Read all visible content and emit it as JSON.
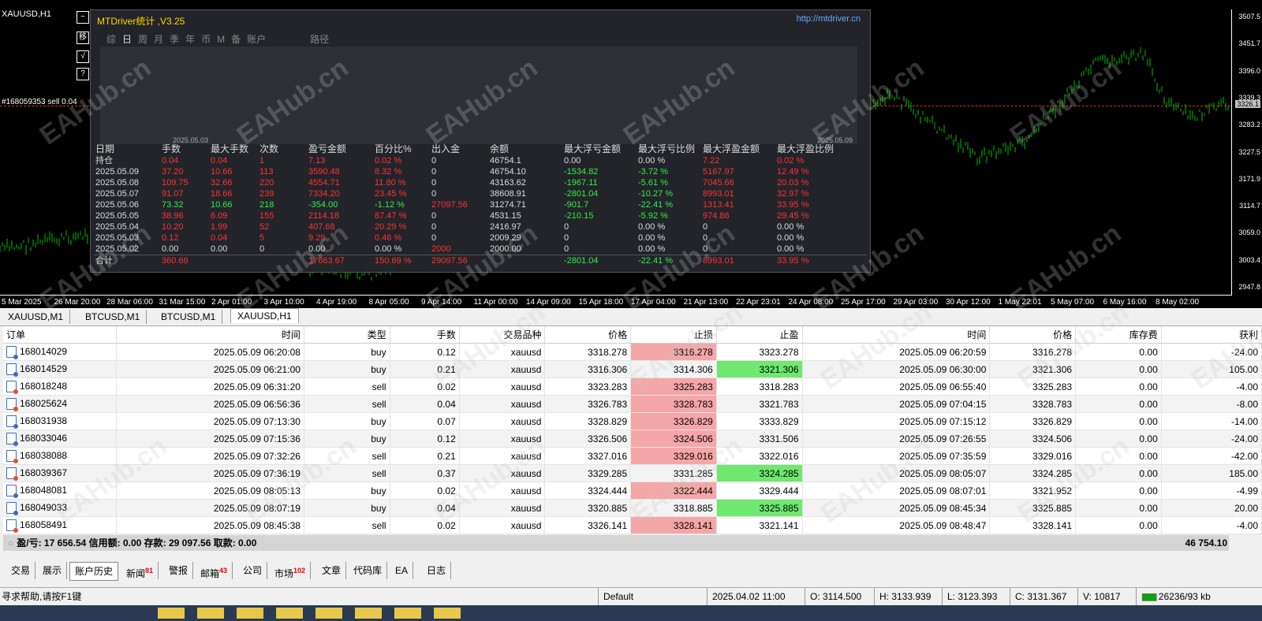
{
  "chart": {
    "title": "XAUUSD,H1",
    "order_tag": "#168059353 sell 0.04",
    "price_labels": [
      "3507.5",
      "3451.7",
      "3396.0",
      "3339.3",
      "3283.2",
      "3227.5",
      "3171.9",
      "3114.7",
      "3059.0",
      "3003.4",
      "2947.8"
    ],
    "current_price": "3326.1",
    "time_labels": [
      "5 Mar 2025",
      "26 Mar 20:00",
      "28 Mar 06:00",
      "31 Mar 15:00",
      "2 Apr 01:00",
      "3 Apr 10:00",
      "4 Apr 19:00",
      "8 Apr 05:00",
      "9 Apr 14:00",
      "11 Apr 00:00",
      "14 Apr 09:00",
      "15 Apr 18:00",
      "17 Apr 04:00",
      "21 Apr 13:00",
      "22 Apr 23:01",
      "24 Apr 08:00",
      "25 Apr 17:00",
      "29 Apr 03:00",
      "30 Apr 12:00",
      "1 May 22:01",
      "5 May 07:00",
      "6 May 16:00",
      "8 May 02:00"
    ],
    "side_buttons": [
      "−",
      "移",
      "√",
      "?"
    ],
    "watermark": "EAHub.cn"
  },
  "panel": {
    "title": "MTDriver统计 ,V3.25",
    "url": "http://mtdriver.cn",
    "tabs": [
      "综",
      "日",
      "周",
      "月",
      "季",
      "年",
      "币",
      "M",
      "备",
      "账户"
    ],
    "active_tab": "日",
    "path_tab": "路径",
    "equity_start_date": "2025.05.03",
    "equity_end_date": "2025.05.09",
    "columns": [
      "日期",
      "手数",
      "最大手数",
      "次数",
      "盈亏金额",
      "百分比%",
      "出入金",
      "余额",
      "最大浮亏金额",
      "最大浮亏比例",
      "最大浮盈金额",
      "最大浮盈比例"
    ],
    "rows": [
      {
        "cells": [
          "持仓",
          "0.04",
          "0.04",
          "1",
          "7.13",
          "0.02 %",
          "0",
          "46754.1",
          "0.00",
          "0.00 %",
          "7.22",
          "0.02 %"
        ],
        "colors": [
          "w",
          "r",
          "r",
          "r",
          "r",
          "r",
          "w",
          "w",
          "w",
          "w",
          "r",
          "r"
        ]
      },
      {
        "cells": [
          "2025.05.09",
          "37.20",
          "10.66",
          "113",
          "3590.48",
          "8.32 %",
          "0",
          "46754.10",
          "-1534.82",
          "-3.72 %",
          "5167.97",
          "12.49 %"
        ],
        "colors": [
          "w",
          "r",
          "r",
          "r",
          "r",
          "r",
          "w",
          "w",
          "g",
          "g",
          "r",
          "r"
        ]
      },
      {
        "cells": [
          "2025.05.08",
          "109.75",
          "32.66",
          "220",
          "4554.71",
          "11.80 %",
          "0",
          "43163.62",
          "-1967.11",
          "-5.61 %",
          "7045.66",
          "20.03 %"
        ],
        "colors": [
          "w",
          "r",
          "r",
          "r",
          "r",
          "r",
          "w",
          "w",
          "g",
          "g",
          "r",
          "r"
        ]
      },
      {
        "cells": [
          "2025.05.07",
          "91.07",
          "18.66",
          "239",
          "7334.20",
          "23.45 %",
          "0",
          "38608.91",
          "-2801.04",
          "-10.27 %",
          "8993.01",
          "32.97 %"
        ],
        "colors": [
          "w",
          "r",
          "r",
          "r",
          "r",
          "r",
          "w",
          "w",
          "g",
          "g",
          "r",
          "r"
        ]
      },
      {
        "cells": [
          "2025.05.06",
          "73.32",
          "10.66",
          "218",
          "-354.00",
          "-1.12 %",
          "27097.56",
          "31274.71",
          "-901.7",
          "-22.41 %",
          "1313.41",
          "33.95 %"
        ],
        "colors": [
          "w",
          "g",
          "g",
          "g",
          "g",
          "g",
          "r",
          "w",
          "g",
          "g",
          "r",
          "r"
        ]
      },
      {
        "cells": [
          "2025.05.05",
          "38.96",
          "6.09",
          "155",
          "2114.18",
          "87.47 %",
          "0",
          "4531.15",
          "-210.15",
          "-5.92 %",
          "974.86",
          "29.45 %"
        ],
        "colors": [
          "w",
          "r",
          "r",
          "r",
          "r",
          "r",
          "w",
          "w",
          "g",
          "g",
          "r",
          "r"
        ]
      },
      {
        "cells": [
          "2025.05.04",
          "10.20",
          "1.99",
          "52",
          "407.68",
          "20.29 %",
          "0",
          "2416.97",
          "0",
          "0.00 %",
          "0",
          "0.00 %"
        ],
        "colors": [
          "w",
          "r",
          "r",
          "r",
          "r",
          "r",
          "w",
          "w",
          "w",
          "w",
          "w",
          "w"
        ]
      },
      {
        "cells": [
          "2025.05.03",
          "0.12",
          "0.04",
          "5",
          "9.29",
          "0.46 %",
          "0",
          "2009.29",
          "0",
          "0.00 %",
          "0",
          "0.00 %"
        ],
        "colors": [
          "w",
          "r",
          "r",
          "r",
          "r",
          "r",
          "w",
          "w",
          "w",
          "w",
          "w",
          "w"
        ]
      },
      {
        "cells": [
          "2025.05.02",
          "0.00",
          "0.00",
          "0",
          "0.00",
          "0.00 %",
          "2000",
          "2000.00",
          "0",
          "0.00 %",
          "0",
          "0.00 %"
        ],
        "colors": [
          "w",
          "w",
          "w",
          "w",
          "w",
          "w",
          "r",
          "w",
          "w",
          "w",
          "w",
          "w"
        ]
      },
      {
        "cells": [
          "合计",
          "360.66",
          "",
          "",
          "17663.67",
          "150.69 %",
          "29097.56",
          "",
          "-2801.04",
          "-22.41 %",
          "8993.01",
          "33.95 %"
        ],
        "colors": [
          "w",
          "r",
          "w",
          "w",
          "r",
          "r",
          "r",
          "w",
          "g",
          "g",
          "r",
          "r"
        ]
      }
    ]
  },
  "symbol_tabs": [
    "XAUUSD,M1",
    "BTCUSD,M1",
    "BTCUSD,M1",
    "XAUUSD,H1"
  ],
  "active_symbol_tab": 3,
  "orders": {
    "columns": [
      "订单",
      "时间",
      "类型",
      "手数",
      "交易品种",
      "价格",
      "止损",
      "止盈",
      "时间",
      "价格",
      "库存费",
      "获利"
    ],
    "rows": [
      {
        "id": "168014029",
        "open_time": "2025.05.09 06:20:08",
        "type": "buy",
        "lots": "0.12",
        "symbol": "xauusd",
        "open_price": "3318.278",
        "sl": "3316.278",
        "tp": "3323.278",
        "close_time": "2025.05.09 06:20:59",
        "close_price": "3316.278",
        "swap": "0.00",
        "profit": "-24.00",
        "hit": "sl"
      },
      {
        "id": "168014529",
        "open_time": "2025.05.09 06:21:00",
        "type": "buy",
        "lots": "0.21",
        "symbol": "xauusd",
        "open_price": "3316.306",
        "sl": "3314.306",
        "tp": "3321.306",
        "close_time": "2025.05.09 06:30:00",
        "close_price": "3321.306",
        "swap": "0.00",
        "profit": "105.00",
        "hit": "tp"
      },
      {
        "id": "168018248",
        "open_time": "2025.05.09 06:31:20",
        "type": "sell",
        "lots": "0.02",
        "symbol": "xauusd",
        "open_price": "3323.283",
        "sl": "3325.283",
        "tp": "3318.283",
        "close_time": "2025.05.09 06:55:40",
        "close_price": "3325.283",
        "swap": "0.00",
        "profit": "-4.00",
        "hit": "sl"
      },
      {
        "id": "168025624",
        "open_time": "2025.05.09 06:56:36",
        "type": "sell",
        "lots": "0.04",
        "symbol": "xauusd",
        "open_price": "3326.783",
        "sl": "3328.783",
        "tp": "3321.783",
        "close_time": "2025.05.09 07:04:15",
        "close_price": "3328.783",
        "swap": "0.00",
        "profit": "-8.00",
        "hit": "sl"
      },
      {
        "id": "168031938",
        "open_time": "2025.05.09 07:13:30",
        "type": "buy",
        "lots": "0.07",
        "symbol": "xauusd",
        "open_price": "3328.829",
        "sl": "3326.829",
        "tp": "3333.829",
        "close_time": "2025.05.09 07:15:12",
        "close_price": "3326.829",
        "swap": "0.00",
        "profit": "-14.00",
        "hit": "sl"
      },
      {
        "id": "168033046",
        "open_time": "2025.05.09 07:15:36",
        "type": "buy",
        "lots": "0.12",
        "symbol": "xauusd",
        "open_price": "3326.506",
        "sl": "3324.506",
        "tp": "3331.506",
        "close_time": "2025.05.09 07:26:55",
        "close_price": "3324.506",
        "swap": "0.00",
        "profit": "-24.00",
        "hit": "sl"
      },
      {
        "id": "168038088",
        "open_time": "2025.05.09 07:32:26",
        "type": "sell",
        "lots": "0.21",
        "symbol": "xauusd",
        "open_price": "3327.016",
        "sl": "3329.016",
        "tp": "3322.016",
        "close_time": "2025.05.09 07:35:59",
        "close_price": "3329.016",
        "swap": "0.00",
        "profit": "-42.00",
        "hit": "sl"
      },
      {
        "id": "168039367",
        "open_time": "2025.05.09 07:36:19",
        "type": "sell",
        "lots": "0.37",
        "symbol": "xauusd",
        "open_price": "3329.285",
        "sl": "3331.285",
        "tp": "3324.285",
        "close_time": "2025.05.09 08:05:07",
        "close_price": "3324.285",
        "swap": "0.00",
        "profit": "185.00",
        "hit": "tp"
      },
      {
        "id": "168048081",
        "open_time": "2025.05.09 08:05:13",
        "type": "buy",
        "lots": "0.02",
        "symbol": "xauusd",
        "open_price": "3324.444",
        "sl": "3322.444",
        "tp": "3329.444",
        "close_time": "2025.05.09 08:07:01",
        "close_price": "3321.952",
        "swap": "0.00",
        "profit": "-4.99",
        "hit": "sl"
      },
      {
        "id": "168049033",
        "open_time": "2025.05.09 08:07:19",
        "type": "buy",
        "lots": "0.04",
        "symbol": "xauusd",
        "open_price": "3320.885",
        "sl": "3318.885",
        "tp": "3325.885",
        "close_time": "2025.05.09 08:45:34",
        "close_price": "3325.885",
        "swap": "0.00",
        "profit": "20.00",
        "hit": "tp"
      },
      {
        "id": "168058491",
        "open_time": "2025.05.09 08:45:38",
        "type": "sell",
        "lots": "0.02",
        "symbol": "xauusd",
        "open_price": "3326.141",
        "sl": "3328.141",
        "tp": "3321.141",
        "close_time": "2025.05.09 08:48:47",
        "close_price": "3328.141",
        "swap": "0.00",
        "profit": "-4.00",
        "hit": "sl"
      }
    ]
  },
  "summary": {
    "text": "盈/亏: 17 656.54  信用额: 0.00  存款: 29 097.56  取款: 0.00",
    "balance": "46 754.10"
  },
  "bottom_tabs": [
    {
      "label": "交易",
      "badge": ""
    },
    {
      "label": "展示",
      "badge": ""
    },
    {
      "label": "账户历史",
      "badge": ""
    },
    {
      "label": "新闻",
      "badge": "81"
    },
    {
      "label": "警报",
      "badge": ""
    },
    {
      "label": "邮箱",
      "badge": "43"
    },
    {
      "label": "公司",
      "badge": ""
    },
    {
      "label": "市场",
      "badge": "102"
    },
    {
      "label": "文章",
      "badge": ""
    },
    {
      "label": "代码库",
      "badge": ""
    },
    {
      "label": "EA",
      "badge": ""
    },
    {
      "label": "日志",
      "badge": ""
    }
  ],
  "active_bottom_tab": 2,
  "status": {
    "help": "寻求帮助,请按F1键",
    "profile": "Default",
    "datetime": "2025.04.02 11:00",
    "open": "O: 3114.500",
    "high": "H: 3133.939",
    "low": "L: 3123.393",
    "close": "C: 3131.367",
    "volume": "V: 10817",
    "traffic": "26236/93 kb"
  },
  "colors": {
    "chart_bg": "#000000",
    "candle": "#00c000",
    "equity_line": "#1fb6ff",
    "sl_bg": "#f5a6a6",
    "tp_bg": "#6ee86e"
  }
}
